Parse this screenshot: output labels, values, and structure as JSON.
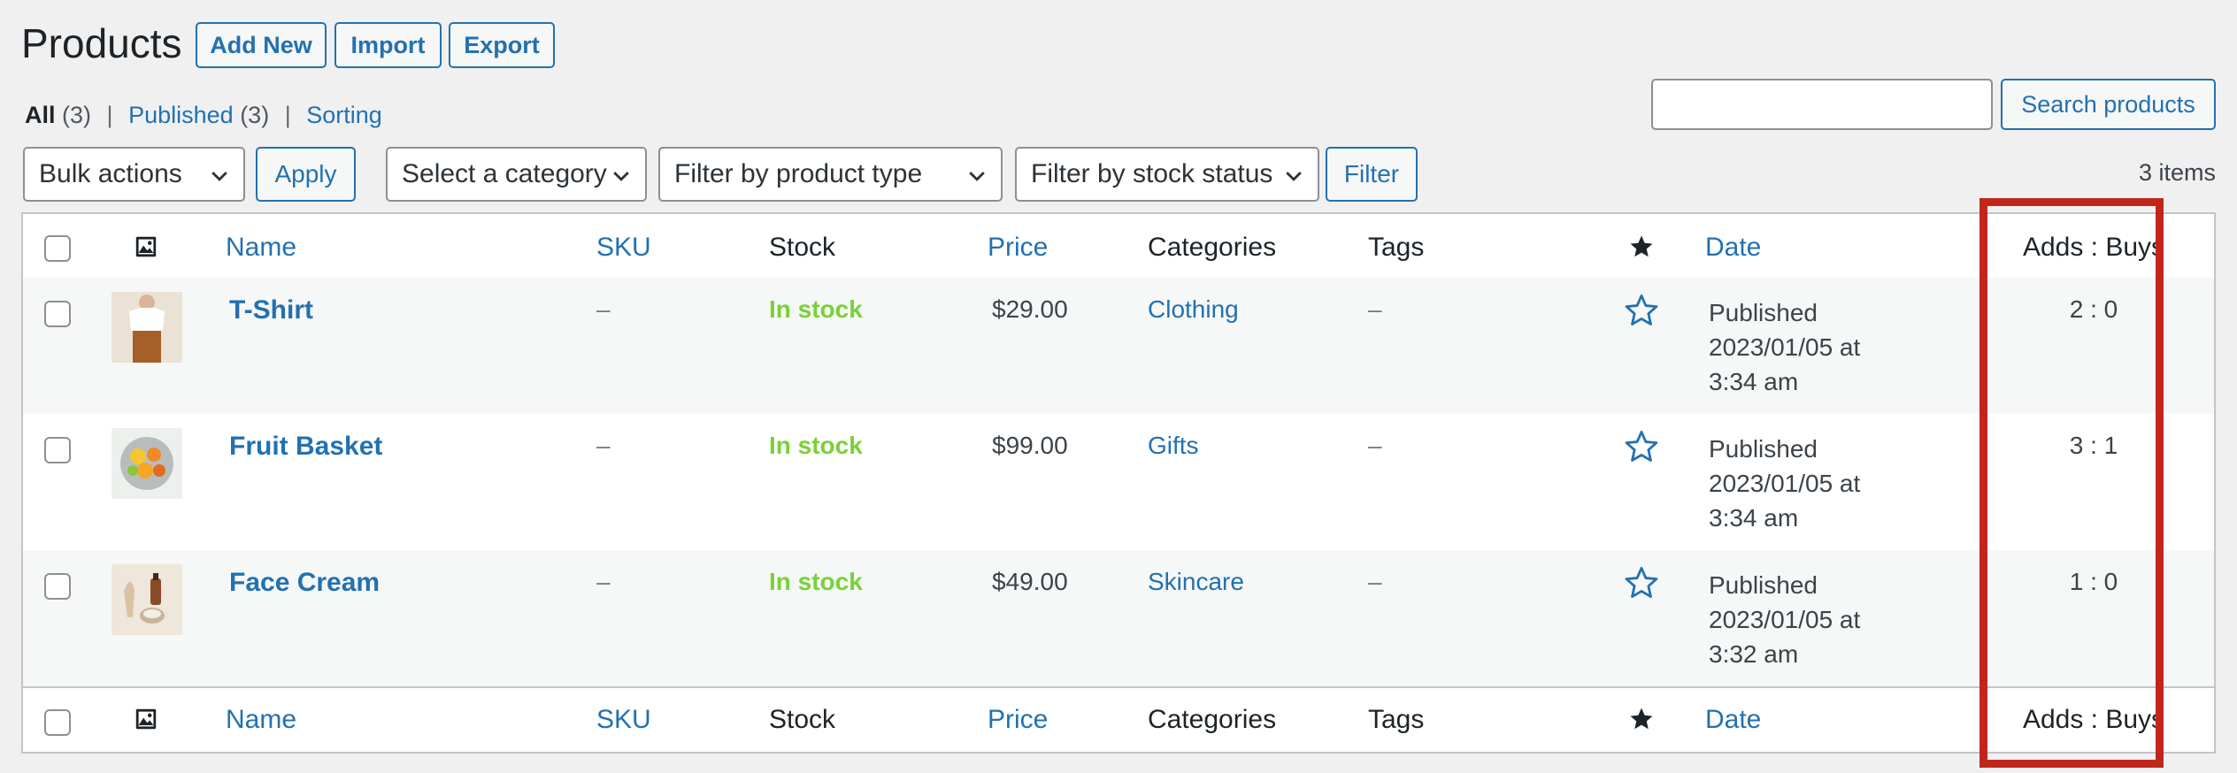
{
  "page": {
    "title": "Products",
    "header_buttons": [
      "Add New",
      "Import",
      "Export"
    ]
  },
  "views": {
    "all_label": "All",
    "all_count": "(3)",
    "published_label": "Published",
    "published_count": "(3)",
    "sorting_label": "Sorting",
    "sep": "|"
  },
  "search": {
    "value": "",
    "button": "Search products"
  },
  "filters": {
    "bulk_actions": "Bulk actions",
    "apply": "Apply",
    "category": "Select a category",
    "product_type": "Filter by product type",
    "stock_status": "Filter by stock status",
    "filter_button": "Filter",
    "items_count": "3 items"
  },
  "columns": {
    "name": "Name",
    "sku": "SKU",
    "stock": "Stock",
    "price": "Price",
    "categories": "Categories",
    "tags": "Tags",
    "date": "Date",
    "adds_buys": "Adds : Buys"
  },
  "products": [
    {
      "name": "T-Shirt",
      "sku": "–",
      "stock": "In stock",
      "price": "$29.00",
      "category": "Clothing",
      "tags": "–",
      "date_status": "Published",
      "date_day": "2023/01/05 at",
      "date_time": "3:34 am",
      "adds_buys": "2 : 0"
    },
    {
      "name": "Fruit Basket",
      "sku": "–",
      "stock": "In stock",
      "price": "$99.00",
      "category": "Gifts",
      "tags": "–",
      "date_status": "Published",
      "date_day": "2023/01/05 at",
      "date_time": "3:34 am",
      "adds_buys": "3 : 1"
    },
    {
      "name": "Face Cream",
      "sku": "–",
      "stock": "In stock",
      "price": "$49.00",
      "category": "Skincare",
      "tags": "–",
      "date_status": "Published",
      "date_day": "2023/01/05 at",
      "date_time": "3:32 am",
      "adds_buys": "1 : 0"
    }
  ],
  "colors": {
    "link": "#2271b1",
    "in_stock": "#7ad03a",
    "highlight": "#c0271c",
    "background": "#f0f0f1"
  }
}
